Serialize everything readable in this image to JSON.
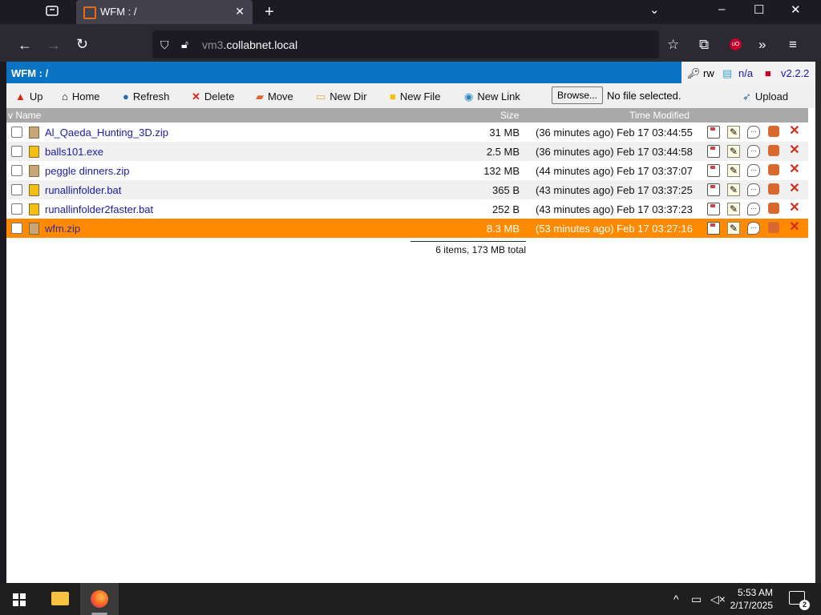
{
  "browser": {
    "tab_title": "WFM : /",
    "tab_close": "✕",
    "new_tab": "+",
    "url_host": "vm3",
    "url_domain": ".collabnet.local",
    "window_controls": {
      "dropdown": "⌄",
      "minimize": "–",
      "maximize": "☐",
      "close": "✕"
    }
  },
  "app": {
    "title": "WFM : /",
    "perm": "rw",
    "quota": "n/a",
    "version": "v2.2.2"
  },
  "toolbar": {
    "up": "Up",
    "home": "Home",
    "refresh": "Refresh",
    "delete": "Delete",
    "move": "Move",
    "new_dir": "New Dir",
    "new_file": "New File",
    "new_link": "New Link",
    "browse": "Browse...",
    "no_file": "No file selected.",
    "upload": "Upload"
  },
  "columns": {
    "name": "v Name",
    "size": "Size",
    "time": "Time Modified"
  },
  "files": [
    {
      "name": "Al_Qaeda_Hunting_3D.zip",
      "size": "31 MB",
      "time": "(36 minutes ago) Feb 17 03:44:55",
      "type": "zip"
    },
    {
      "name": "balls101.exe",
      "size": "2.5 MB",
      "time": "(36 minutes ago) Feb 17 03:44:58",
      "type": "doc"
    },
    {
      "name": "peggle dinners.zip",
      "size": "132 MB",
      "time": "(44 minutes ago) Feb 17 03:37:07",
      "type": "zip"
    },
    {
      "name": "runallinfolder.bat",
      "size": "365 B",
      "time": "(43 minutes ago) Feb 17 03:37:25",
      "type": "doc"
    },
    {
      "name": "runallinfolder2faster.bat",
      "size": "252 B",
      "time": "(43 minutes ago) Feb 17 03:37:23",
      "type": "doc"
    },
    {
      "name": "wfm.zip",
      "size": "8.3 MB",
      "time": "(53 minutes ago) Feb 17 03:27:16",
      "type": "zip",
      "selected": true
    }
  ],
  "summary": "6 items, 173 MB total",
  "taskbar": {
    "time": "5:53 AM",
    "date": "2/17/2025",
    "notifications": "2"
  }
}
